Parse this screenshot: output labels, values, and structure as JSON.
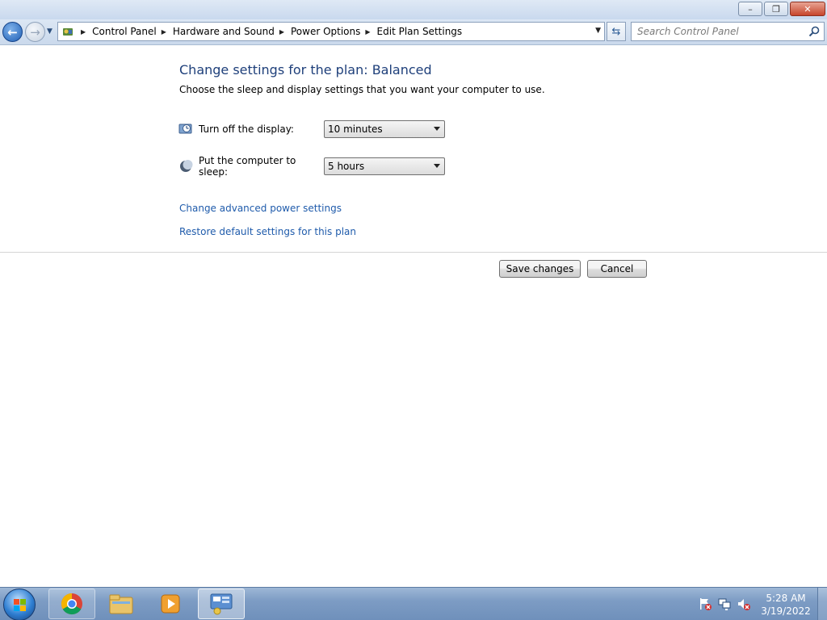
{
  "window": {
    "minimize_glyph": "–",
    "restore_glyph": "❐",
    "close_glyph": "✕"
  },
  "navigation": {
    "back_glyph": "←",
    "forward_glyph": "→",
    "recent_glyph": "▼",
    "refresh_glyph": "⇆",
    "breadcrumbs": [
      {
        "label": "Control Panel"
      },
      {
        "label": "Hardware and Sound"
      },
      {
        "label": "Power Options"
      },
      {
        "label": "Edit Plan Settings"
      }
    ],
    "search": {
      "placeholder": "Search Control Panel",
      "value": ""
    }
  },
  "main": {
    "title": "Change settings for the plan: Balanced",
    "subtitle": "Choose the sleep and display settings that you want your computer to use.",
    "settings": [
      {
        "label": "Turn off the display:",
        "selected": "10 minutes",
        "icon": "display-icon"
      },
      {
        "label": "Put the computer to sleep:",
        "selected": "5 hours",
        "icon": "sleep-icon"
      }
    ],
    "links": {
      "advanced": "Change advanced power settings",
      "restore": "Restore default settings for this plan"
    },
    "buttons": {
      "save": "Save changes",
      "cancel": "Cancel"
    }
  },
  "taskbar": {
    "items": [
      {
        "name": "chrome-icon",
        "state": "pinned"
      },
      {
        "name": "file-explorer-icon",
        "state": "pinned"
      },
      {
        "name": "media-player-icon",
        "state": "pinned"
      },
      {
        "name": "control-panel-icon",
        "state": "active"
      }
    ],
    "tray_icons": [
      "action-center-flag-icon",
      "network-icon",
      "volume-muted-icon"
    ],
    "clock": {
      "time": "5:28 AM",
      "date": "3/19/2022"
    }
  },
  "colors": {
    "title_blue": "#1e3f7a",
    "link_blue": "#1f5bab",
    "taskbar": "#7d9cc4"
  }
}
